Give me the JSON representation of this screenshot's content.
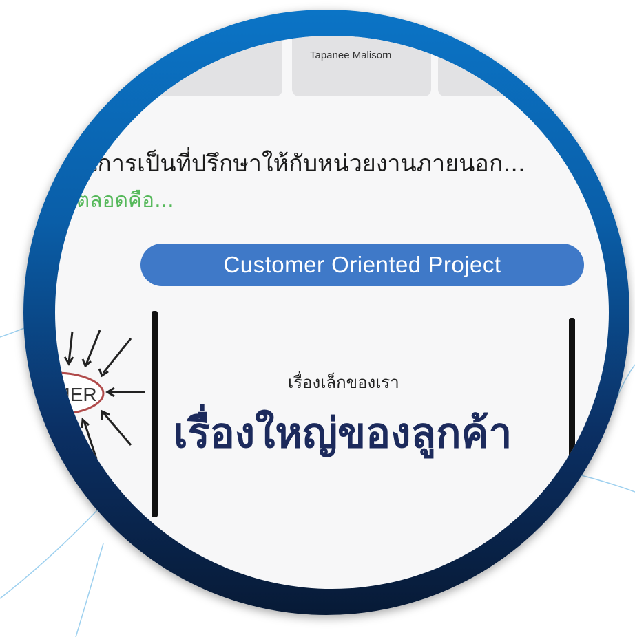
{
  "profile_tiles": {
    "name": "Tapanee Malisorn"
  },
  "content": {
    "thai_line": "นการเป็นที่ปรึกษาให้กับหน่วยงานภายนอก...",
    "green_line": "มาตลอดคือ...",
    "pill_label": "Customer Oriented Project",
    "diagram_word": "TOMER",
    "small_thai": "เรื่องเล็กของเรา",
    "big_thai": "เรื่องใหญ่ของลูกค้า"
  },
  "colors": {
    "ring": "#0b5ea8",
    "pill": "#3f79c8",
    "green_text": "#55b85a",
    "big_text": "#1c2a5c",
    "background_lines": "#7fc3ea"
  }
}
